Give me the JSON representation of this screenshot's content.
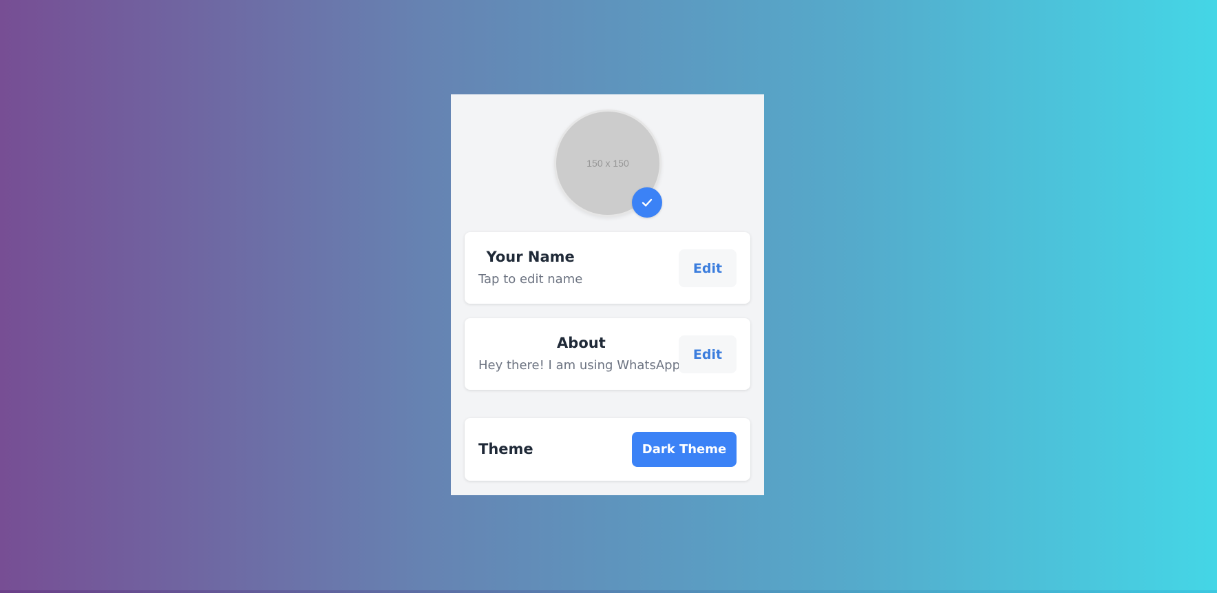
{
  "colors": {
    "accent": "#3b82f6",
    "panel_bg": "#f3f4f6",
    "gradient_start": "#774e94",
    "gradient_end": "#44d6e6"
  },
  "profile": {
    "avatar_placeholder": "150 x 150",
    "badge_icon": "check-icon"
  },
  "name_card": {
    "title": "Your Name",
    "value": "Tap to edit name",
    "edit_label": "Edit"
  },
  "about_card": {
    "title": "About",
    "value": "Hey there! I am using WhatsApp.",
    "edit_label": "Edit"
  },
  "theme_card": {
    "label": "Theme",
    "button_label": "Dark Theme"
  }
}
